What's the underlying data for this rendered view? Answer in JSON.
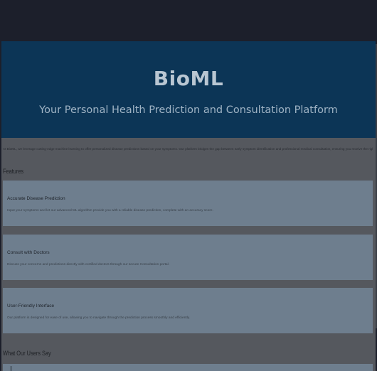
{
  "hero": {
    "title": "BioML",
    "tagline": "Your Personal Health Prediction and Consultation Platform"
  },
  "intro": "At BioML, we leverage cutting-edge machine learning to offer personalized disease predictions based on your symptoms. Our platform bridges the gap between early symptom identification and professional medical consultation, ensuring you receive the right guidance at the right time.",
  "features": {
    "heading": "Features",
    "items": [
      {
        "title": "Accurate Disease Prediction",
        "desc": "Input your symptoms and let our advanced ML algorithm provide you with a reliable disease prediction, complete with an accuracy score."
      },
      {
        "title": "Consult with Doctors",
        "desc": "Discuss your concerns and predictions directly with certified doctors through our secure Consultation portal."
      },
      {
        "title": "User-Friendly Interface",
        "desc": "Our platform is designed for ease of use, allowing you to navigate through the prediction process smoothly and efficiently."
      }
    ]
  },
  "testimonials": {
    "heading": "What Our Users Say"
  },
  "colors": {
    "hero_bg": "#0c3556",
    "page_bg": "#55585e",
    "card_bg": "#6e7e8e",
    "chrome_bg": "#1c1f2b"
  }
}
